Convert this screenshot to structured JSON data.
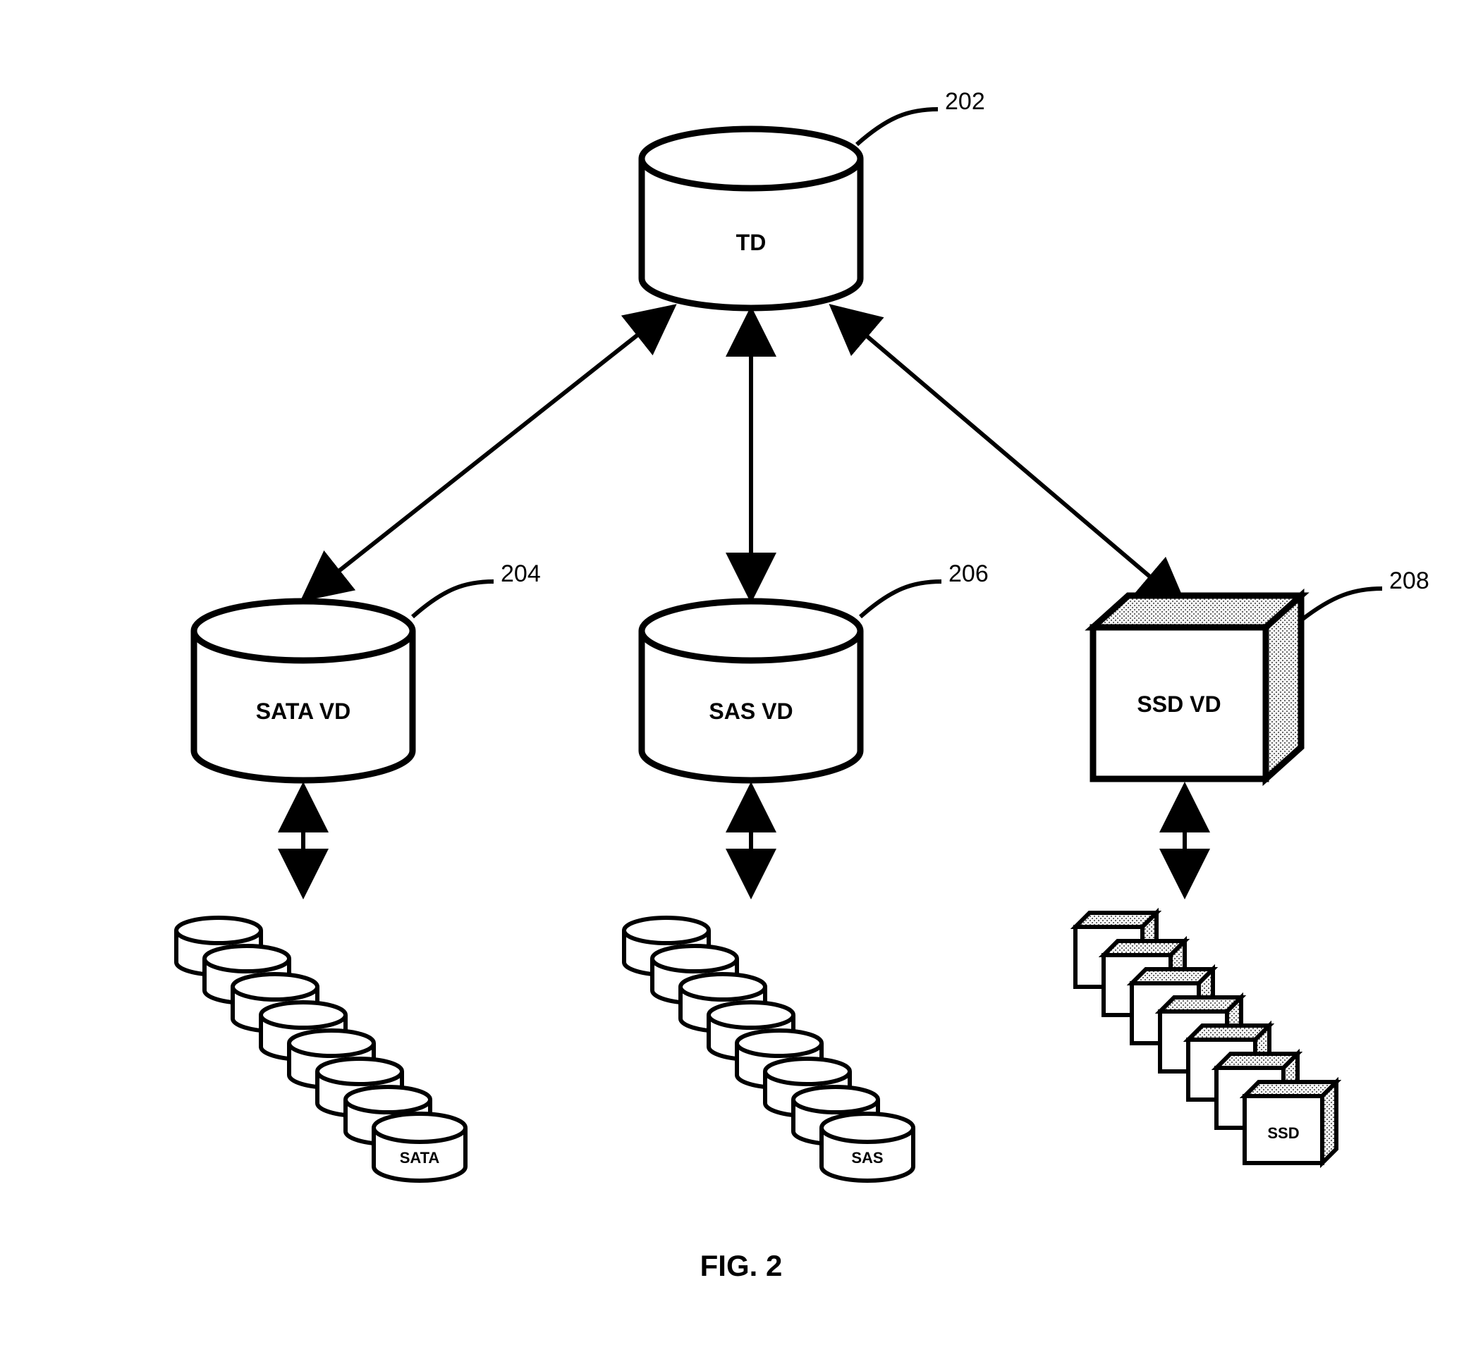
{
  "figure": {
    "caption": "FIG. 2",
    "nodes": {
      "td": {
        "label": "TD",
        "ref": "202"
      },
      "sata_vd": {
        "label": "SATA VD",
        "ref": "204"
      },
      "sas_vd": {
        "label": "SAS VD",
        "ref": "206"
      },
      "ssd_vd": {
        "label": "SSD VD",
        "ref": "208"
      }
    },
    "stacks": {
      "sata": {
        "label": "SATA",
        "count": 8
      },
      "sas": {
        "label": "SAS",
        "count": 8
      },
      "ssd": {
        "label": "SSD",
        "count": 7
      }
    }
  }
}
